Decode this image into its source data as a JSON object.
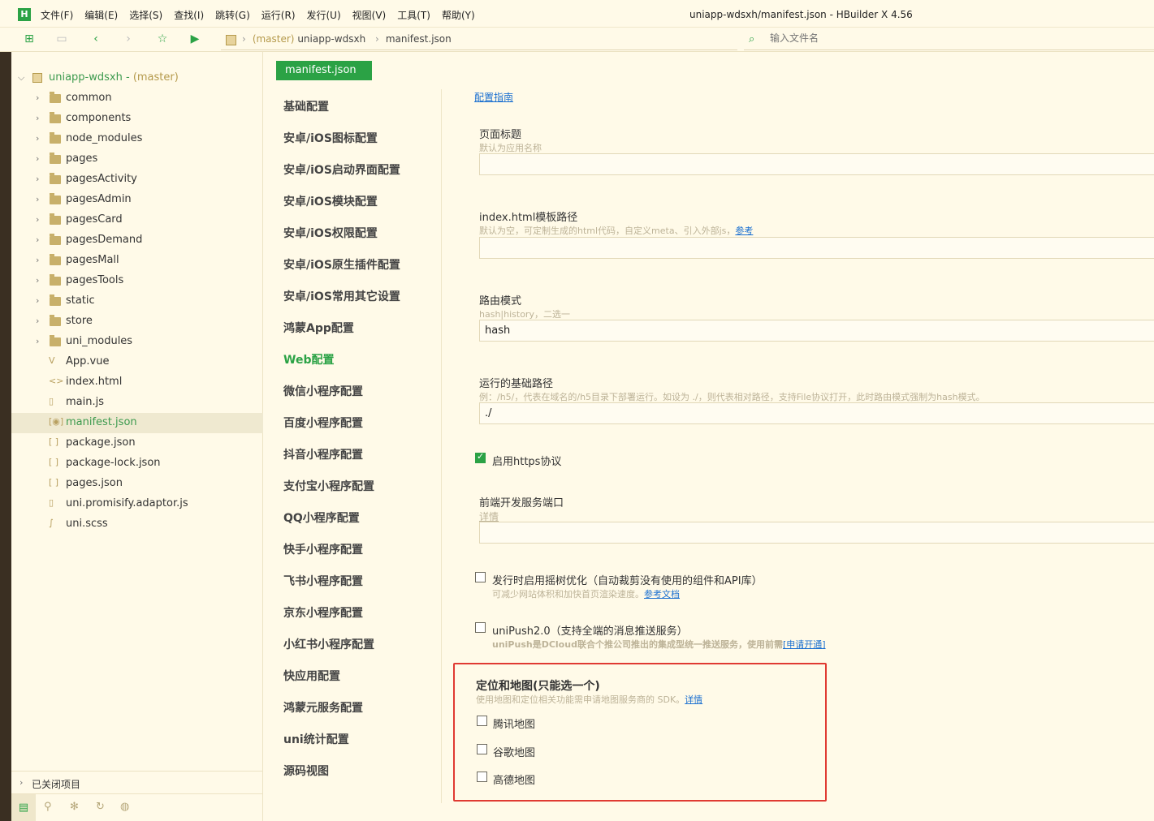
{
  "menubar": {
    "logo": "H",
    "items": [
      "文件(F)",
      "编辑(E)",
      "选择(S)",
      "查找(I)",
      "跳转(G)",
      "运行(R)",
      "发行(U)",
      "视图(V)",
      "工具(T)",
      "帮助(Y)"
    ],
    "window_title": "uniapp-wdsxh/manifest.json - HBuilder X 4.56"
  },
  "toolbar": {
    "icons": [
      "new-file-icon",
      "save-icon",
      "back-icon",
      "forward-icon",
      "star-icon",
      "run-icon"
    ],
    "breadcrumb": {
      "branch": "(master)",
      "project": "uniapp-wdsxh",
      "file": "manifest.json"
    },
    "file_search_placeholder": "输入文件名"
  },
  "sidebar": {
    "project": {
      "name": "uniapp-wdsxh",
      "branch": "(master)"
    },
    "items": [
      {
        "label": "common",
        "type": "folder"
      },
      {
        "label": "components",
        "type": "folder"
      },
      {
        "label": "node_modules",
        "type": "folder"
      },
      {
        "label": "pages",
        "type": "folder"
      },
      {
        "label": "pagesActivity",
        "type": "folder"
      },
      {
        "label": "pagesAdmin",
        "type": "folder"
      },
      {
        "label": "pagesCard",
        "type": "folder"
      },
      {
        "label": "pagesDemand",
        "type": "folder"
      },
      {
        "label": "pagesMall",
        "type": "folder"
      },
      {
        "label": "pagesTools",
        "type": "folder"
      },
      {
        "label": "static",
        "type": "folder"
      },
      {
        "label": "store",
        "type": "folder"
      },
      {
        "label": "uni_modules",
        "type": "folder"
      },
      {
        "label": "App.vue",
        "type": "file"
      },
      {
        "label": "index.html",
        "type": "file"
      },
      {
        "label": "main.js",
        "type": "file"
      },
      {
        "label": "manifest.json",
        "type": "file",
        "selected": true
      },
      {
        "label": "package.json",
        "type": "file"
      },
      {
        "label": "package-lock.json",
        "type": "file"
      },
      {
        "label": "pages.json",
        "type": "file"
      },
      {
        "label": "uni.promisify.adaptor.js",
        "type": "file"
      },
      {
        "label": "uni.scss",
        "type": "file"
      }
    ],
    "closed_projects": "已关闭项目"
  },
  "editor": {
    "tab": "manifest.json"
  },
  "settings_nav": {
    "items": [
      "基础配置",
      "安卓/iOS图标配置",
      "安卓/iOS启动界面配置",
      "安卓/iOS模块配置",
      "安卓/iOS权限配置",
      "安卓/iOS原生插件配置",
      "安卓/iOS常用其它设置",
      "鸿蒙App配置",
      "Web配置",
      "微信小程序配置",
      "百度小程序配置",
      "抖音小程序配置",
      "支付宝小程序配置",
      "QQ小程序配置",
      "快手小程序配置",
      "飞书小程序配置",
      "京东小程序配置",
      "小红书小程序配置",
      "快应用配置",
      "鸿蒙元服务配置",
      "uni统计配置",
      "源码视图"
    ],
    "active": "Web配置"
  },
  "form": {
    "guide_link": "配置指南",
    "page_title": {
      "label": "页面标题",
      "hint": "默认为应用名称",
      "value": ""
    },
    "index_template": {
      "label": "index.html模板路径",
      "hint": "默认为空，可定制生成的html代码，自定义meta、引入外部js，",
      "hint_link": "参考",
      "value": ""
    },
    "router_mode": {
      "label": "路由模式",
      "hint": "hash|history，二选一",
      "value": "hash"
    },
    "base_path": {
      "label": "运行的基础路径",
      "hint": "例：/h5/，代表在域名的/h5目录下部署运行。如设为 ./，则代表相对路径，支持File协议打开，此时路由模式强制为hash模式。",
      "value": "./"
    },
    "https": {
      "label": "启用https协议",
      "checked": true
    },
    "dev_port": {
      "label": "前端开发服务端口",
      "link": "详情",
      "value": ""
    },
    "tree_shaking": {
      "label": "发行时启用摇树优化（自动裁剪没有使用的组件和API库）",
      "hint": "可减少网站体积和加快首页渲染速度。",
      "hint_link": "参考文档",
      "checked": false
    },
    "unipush": {
      "label": "uniPush2.0（支持全端的消息推送服务）",
      "hint": "uniPush是DCloud联合个推公司推出的集成型统一推送服务，使用前需",
      "hint_link": "[申请开通]",
      "checked": false
    },
    "map": {
      "title": "定位和地图(只能选一个)",
      "hint": "使用地图和定位相关功能需申请地图服务商的 SDK。",
      "hint_link": "详情",
      "options": [
        {
          "label": "腾讯地图",
          "checked": false
        },
        {
          "label": "谷歌地图",
          "checked": false
        },
        {
          "label": "高德地图",
          "checked": false
        }
      ]
    }
  },
  "colors": {
    "accent": "#2ba245",
    "background": "#fffae8",
    "highlight_border": "#e03a32",
    "link": "#1a6fd0"
  }
}
